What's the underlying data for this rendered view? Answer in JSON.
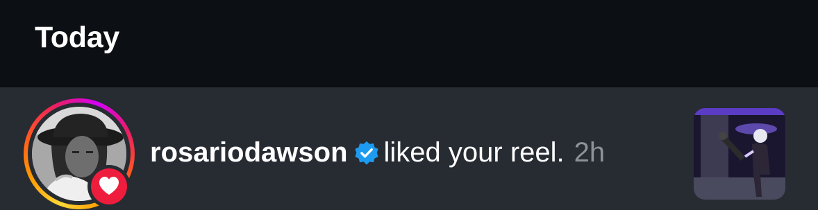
{
  "header": {
    "title": "Today"
  },
  "notification": {
    "username": "rosariodawson",
    "action": "liked your reel.",
    "time": "2h",
    "verified": true,
    "avatar_icon": "profile-photo",
    "badge_icon": "heart-icon",
    "thumbnail_icon": "reel-thumbnail"
  },
  "colors": {
    "background": "#0c0f14",
    "row_background": "#272b32",
    "verified_blue": "#1d9bf0",
    "heart_red": "#ee1d3d",
    "muted_text": "#8e9299"
  }
}
